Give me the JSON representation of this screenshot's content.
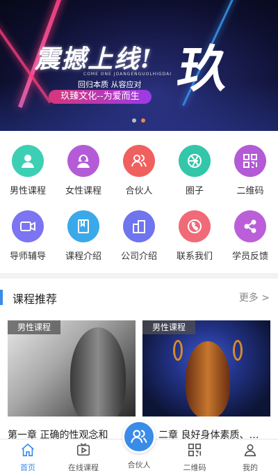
{
  "banner": {
    "headline": "震撼上线!",
    "big_char": "玖",
    "english_small": "COME ONE JOANGENGUOLHIGDAI",
    "slogan": "回归本质  从容应对",
    "pill": "玖臻文化--为爱而生",
    "slide_count": 2,
    "active_slide": 2
  },
  "grid": [
    {
      "label": "男性课程",
      "icon": "male-avatar-icon",
      "color": "#3ccfb4"
    },
    {
      "label": "女性课程",
      "icon": "female-avatar-icon",
      "color": "#b45cd8"
    },
    {
      "label": "合伙人",
      "icon": "partners-icon",
      "color": "#f0605f"
    },
    {
      "label": "圈子",
      "icon": "circle-aperture-icon",
      "color": "#33c6a9"
    },
    {
      "label": "二维码",
      "icon": "qrcode-icon",
      "color": "#b35ad6"
    },
    {
      "label": "导师辅导",
      "icon": "video-camera-icon",
      "color": "#7c74f0"
    },
    {
      "label": "课程介绍",
      "icon": "book-icon",
      "color": "#3aa9ea"
    },
    {
      "label": "公司介绍",
      "icon": "building-icon",
      "color": "#6f74ef"
    },
    {
      "label": "联系我们",
      "icon": "phone-icon",
      "color": "#f06a78"
    },
    {
      "label": "学员反馈",
      "icon": "share-icon",
      "color": "#bb5fd8"
    }
  ],
  "section": {
    "title": "课程推荐",
    "more": "更多 >"
  },
  "courses": [
    {
      "tag": "男性课程",
      "title": "第一章 正确的性观念和"
    },
    {
      "tag": "男性课程",
      "title": "二章 良好身体素质、…"
    }
  ],
  "nav": [
    {
      "label": "首页",
      "icon": "home-icon"
    },
    {
      "label": "在线课程",
      "icon": "play-tv-icon"
    },
    {
      "label": "合伙人",
      "icon": "partners-icon"
    },
    {
      "label": "二维码",
      "icon": "qrcode-icon"
    },
    {
      "label": "我的",
      "icon": "user-icon"
    }
  ],
  "colors": {
    "accent": "#3b8be8",
    "dot_active": "#f0883e"
  }
}
